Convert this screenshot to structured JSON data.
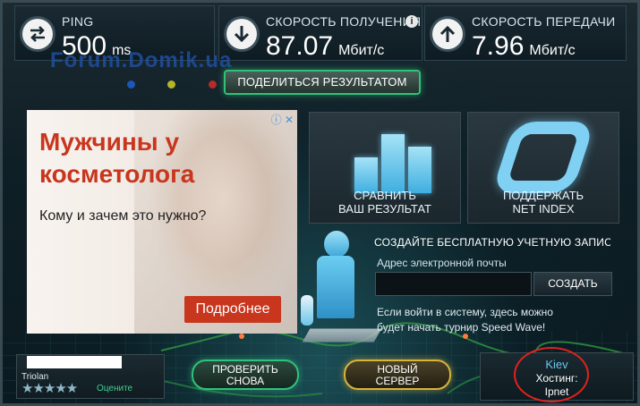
{
  "watermark": "Forum.Domik.ua",
  "metrics": {
    "ping": {
      "label": "PING",
      "value": "500",
      "unit": "ms"
    },
    "download": {
      "label": "СКОРОСТЬ ПОЛУЧЕНИЯ",
      "value": "87.07",
      "unit": "Мбит/с"
    },
    "upload": {
      "label": "СКОРОСТЬ ПЕРЕДАЧИ",
      "value": "7.96",
      "unit": "Мбит/с"
    }
  },
  "share_button": "ПОДЕЛИТЬСЯ РЕЗУЛЬТАТОМ",
  "indicator_dots": [
    "#1d56b8",
    "#b8b42a",
    "#b82a2a"
  ],
  "ad": {
    "title": "Мужчины у косметолога",
    "subtitle": "Кому и зачем это нужно?",
    "button": "Подробнее"
  },
  "tiles": {
    "compare": {
      "line1": "СРАВНИТЬ",
      "line2": "ВАШ РЕЗУЛЬТАТ"
    },
    "support": {
      "line1": "ПОДДЕРЖАТЬ",
      "line2": "NET INDEX"
    }
  },
  "signup": {
    "title": "СОЗДАЙТЕ БЕСПЛАТНУЮ УЧЕТНУЮ ЗАПИСЬ",
    "email_label": "Адрес электронной почты",
    "email_value": "",
    "create_button": "СОЗДАТЬ",
    "note": "Если войти в систему, здесь можно будет начать турнир Speed Wave!"
  },
  "isp": {
    "name": "Triolan",
    "rate_label": "Оцените",
    "stars": "★★★★★"
  },
  "buttons": {
    "retest": {
      "line1": "ПРОВЕРИТЬ",
      "line2": "СНОВА"
    },
    "new_server": {
      "line1": "НОВЫЙ",
      "line2": "СЕРВЕР"
    }
  },
  "server": {
    "city": "Kiev",
    "host_label": "Хостинг:",
    "host_name": "Ipnet"
  },
  "colors": {
    "accent_green": "#2ec27a",
    "accent_gold": "#d8b43a",
    "accent_blue": "#6cc6ee",
    "ad_red": "#c8361e",
    "annotation_red": "#e0221e"
  }
}
